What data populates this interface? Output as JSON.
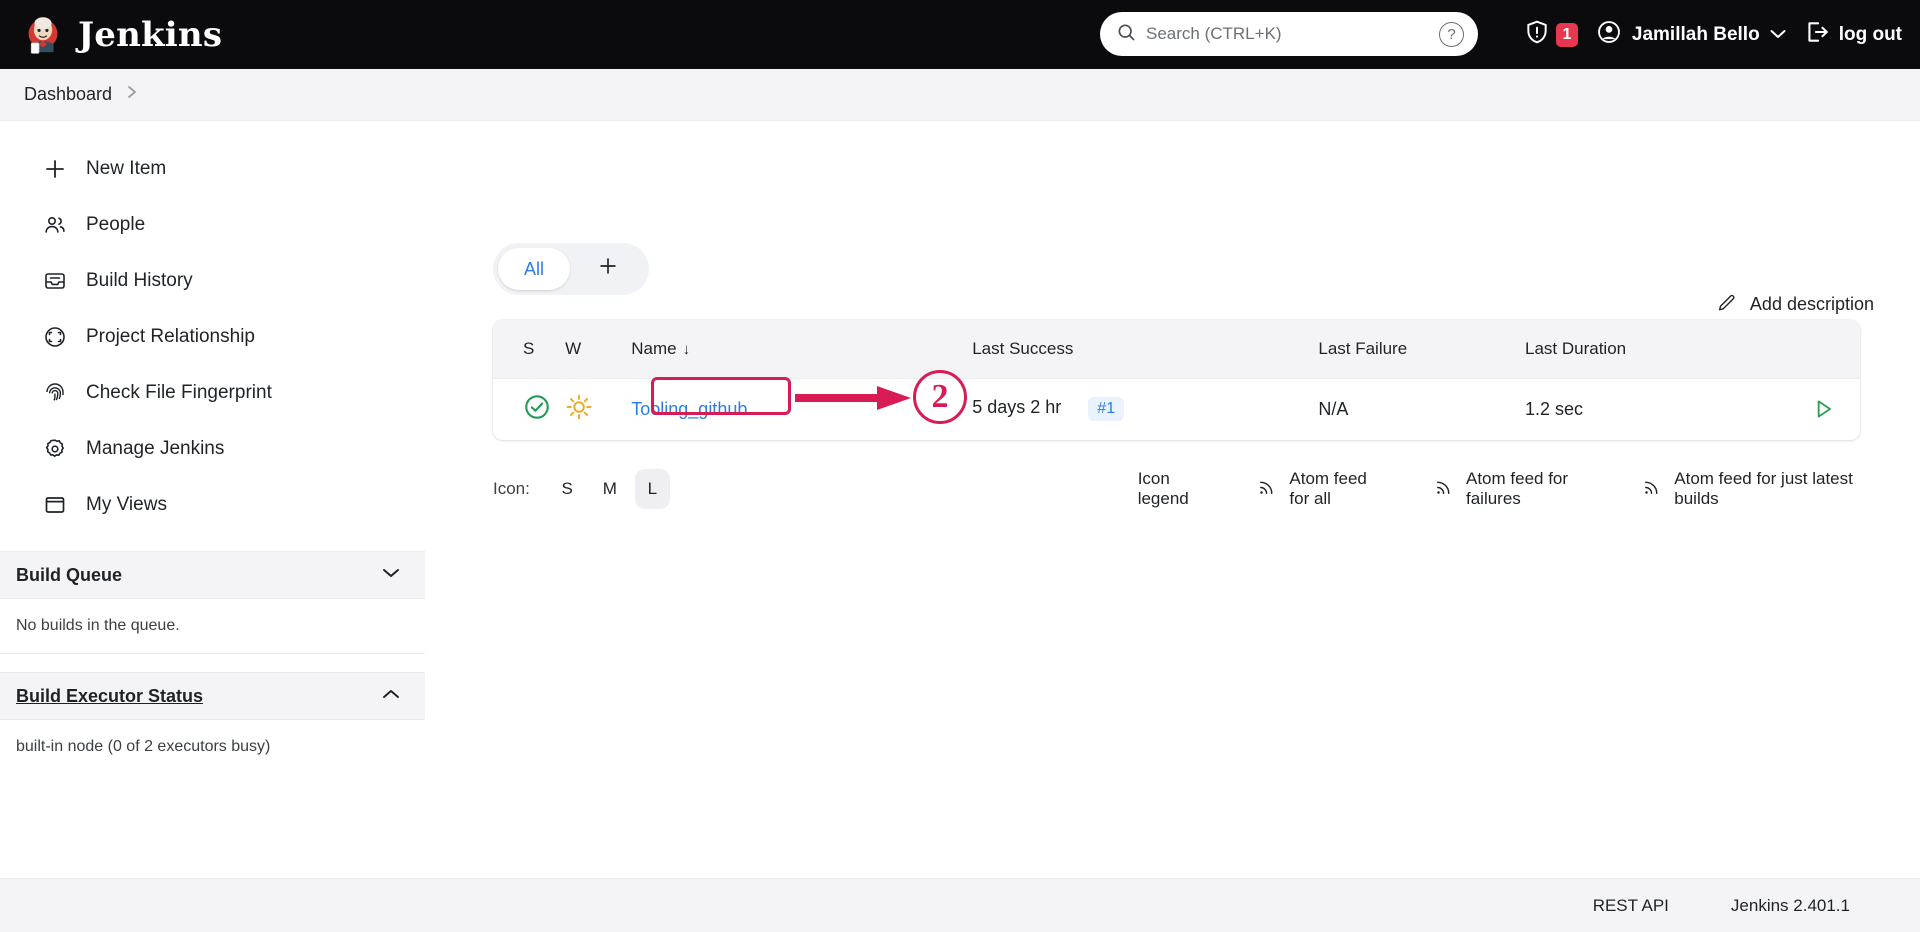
{
  "header": {
    "brand": "Jenkins",
    "brand_logo_icon": "jenkins-butler-logo",
    "search": {
      "placeholder": "Search (CTRL+K)",
      "value": "",
      "search_icon": "search-icon",
      "help_icon": "help-circle-icon"
    },
    "alerts": {
      "icon": "shield-exclamation-icon",
      "count": "1"
    },
    "user": {
      "name": "Jamillah Bello",
      "avatar_icon": "user-circle-icon",
      "chevron_icon": "chevron-down-icon"
    },
    "logout": {
      "label": "log out",
      "icon": "logout-icon"
    }
  },
  "breadcrumb": {
    "items": [
      "Dashboard"
    ],
    "separator": "›"
  },
  "sidebar": {
    "items": [
      {
        "label": "New Item",
        "icon": "plus-icon"
      },
      {
        "label": "People",
        "icon": "people-icon"
      },
      {
        "label": "Build History",
        "icon": "inbox-icon"
      },
      {
        "label": "Project Relationship",
        "icon": "target-icon"
      },
      {
        "label": "Check File Fingerprint",
        "icon": "fingerprint-icon"
      },
      {
        "label": "Manage Jenkins",
        "icon": "gear-icon"
      },
      {
        "label": "My Views",
        "icon": "window-icon"
      }
    ],
    "build_queue": {
      "title": "Build Queue",
      "chevron_icon": "chevron-down-icon",
      "body": "No builds in the queue."
    },
    "build_executor_status": {
      "title": "Build Executor Status",
      "chevron_icon": "chevron-up-icon",
      "body": "built-in node (0 of 2 executors busy)"
    }
  },
  "main": {
    "add_description": {
      "label": "Add description",
      "icon": "pencil-icon"
    },
    "tabs": [
      {
        "label": "All",
        "active": true
      },
      {
        "label": "+",
        "active": false,
        "icon": "plus-icon"
      }
    ],
    "table": {
      "columns": [
        "S",
        "W",
        "Name",
        "Last Success",
        "Last Failure",
        "Last Duration",
        ""
      ],
      "sort_column": "Name",
      "sort_arrow": "↓",
      "rows": [
        {
          "status_icon": "check-circle-green-icon",
          "weather_icon": "sunny-icon",
          "name": "Tooling_github",
          "last_success": "5 days 2 hr",
          "last_success_build": "#1",
          "last_failure": "N/A",
          "last_duration": "1.2 sec",
          "action_icon": "play-triangle-icon"
        }
      ]
    },
    "footer_row": {
      "icon_label": "Icon:",
      "sizes": [
        {
          "label": "S",
          "active": false
        },
        {
          "label": "M",
          "active": false
        },
        {
          "label": "L",
          "active": true
        }
      ],
      "links": [
        {
          "label": "Icon legend",
          "icon": null
        },
        {
          "label": "Atom feed for all",
          "icon": "rss-icon"
        },
        {
          "label": "Atom feed for failures",
          "icon": "rss-icon"
        },
        {
          "label": "Atom feed for just latest builds",
          "icon": "rss-icon"
        }
      ]
    }
  },
  "footer": {
    "rest_api": "REST API",
    "version": "Jenkins 2.401.1"
  },
  "annotations": {
    "marker_number": "2",
    "color": "#d81b52"
  },
  "colors": {
    "topbar_bg": "#0b0b0d",
    "link_blue": "#2b7ce9",
    "success_green": "#1f9d55",
    "weather_yellow": "#f0ab29",
    "alert_red": "#e8384f",
    "panel_bg": "#f4f4f6",
    "annotation_red": "#d81b52"
  }
}
